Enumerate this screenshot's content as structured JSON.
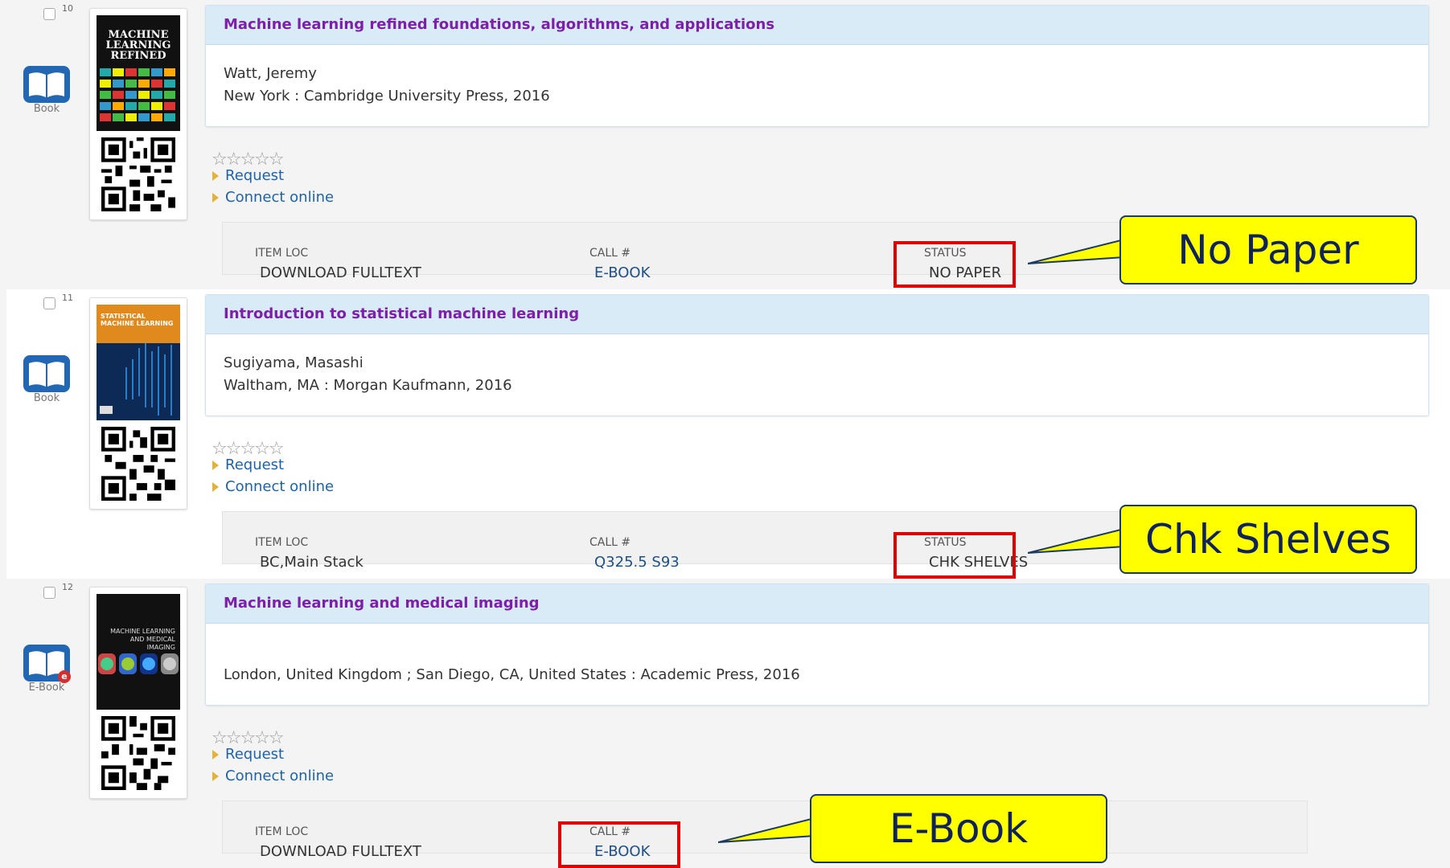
{
  "records": [
    {
      "number": "10",
      "type_label": "Book",
      "cover_title": "MACHINE LEARNING REFINED",
      "title": "Machine learning refined foundations, algorithms, and applications",
      "author": "Watt, Jeremy",
      "publisher": "New York : Cambridge University Press, 2016",
      "request_label": "Request",
      "connect_label": "Connect online",
      "holdings": {
        "item_loc_header": "ITEM LOC",
        "call_header": "CALL #",
        "status_header": "STATUS",
        "item_loc": "DOWNLOAD FULLTEXT",
        "call": "E-BOOK",
        "status": "NO PAPER"
      },
      "callout": "No Paper"
    },
    {
      "number": "11",
      "type_label": "Book",
      "cover_title": "STATISTICAL MACHINE LEARNING",
      "title": "Introduction to statistical machine learning",
      "author": "Sugiyama, Masashi",
      "publisher": "Waltham, MA : Morgan Kaufmann, 2016",
      "request_label": "Request",
      "connect_label": "Connect online",
      "holdings": {
        "item_loc_header": "ITEM LOC",
        "call_header": "CALL #",
        "status_header": "STATUS",
        "item_loc": "BC,Main Stack",
        "call": "Q325.5 S93",
        "status": "CHK SHELVES"
      },
      "callout": "Chk Shelves"
    },
    {
      "number": "12",
      "type_label": "E-Book",
      "cover_title": "MACHINE LEARNING AND MEDICAL IMAGING",
      "title": "Machine learning and medical imaging",
      "author": "",
      "publisher": "London, United Kingdom ; San Diego, CA, United States : Academic Press, 2016",
      "request_label": "Request",
      "connect_label": "Connect online",
      "holdings": {
        "item_loc_header": "ITEM LOC",
        "call_header": "CALL #",
        "item_loc": "DOWNLOAD FULLTEXT",
        "call": "E-BOOK"
      },
      "callout": "E-Book"
    }
  ],
  "colors": {
    "title": "#7d1fa8",
    "link": "#1e62a8",
    "callout_bg": "#ffff00",
    "highlight": "#e00000"
  },
  "icons": [
    "open-book-icon",
    "checkbox",
    "star-outline-icon",
    "triangle-bullet-icon",
    "qr-code"
  ]
}
